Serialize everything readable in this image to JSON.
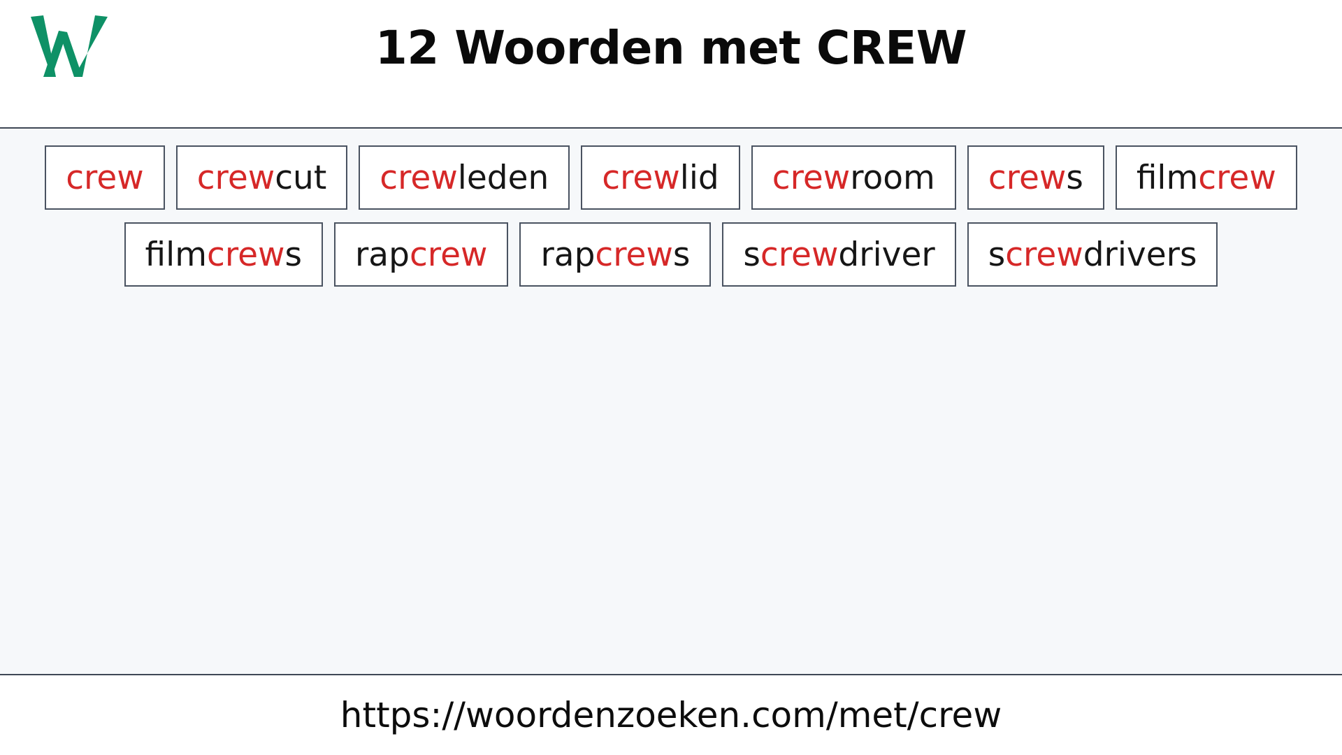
{
  "header": {
    "logo_icon": "w-logo-icon",
    "logo_letter": "W",
    "logo_color": "#0e9166",
    "title": "12 Woorden met CREW"
  },
  "theme": {
    "highlight_color": "#d62828",
    "text_color": "#161616",
    "chip_border_color": "#4a5361",
    "content_background": "#f6f8fa",
    "rule_color": "#3f4855"
  },
  "main": {
    "rows": [
      {
        "chips": [
          {
            "word": "crew",
            "parts": [
              {
                "text": "crew",
                "highlight": true
              }
            ]
          },
          {
            "word": "crewcut",
            "parts": [
              {
                "text": "crew",
                "highlight": true
              },
              {
                "text": "cut",
                "highlight": false
              }
            ]
          },
          {
            "word": "crewleden",
            "parts": [
              {
                "text": "crew",
                "highlight": true
              },
              {
                "text": "leden",
                "highlight": false
              }
            ]
          },
          {
            "word": "crewlid",
            "parts": [
              {
                "text": "crew",
                "highlight": true
              },
              {
                "text": "lid",
                "highlight": false
              }
            ]
          },
          {
            "word": "crewroom",
            "parts": [
              {
                "text": "crew",
                "highlight": true
              },
              {
                "text": "room",
                "highlight": false
              }
            ]
          },
          {
            "word": "crews",
            "parts": [
              {
                "text": "crew",
                "highlight": true
              },
              {
                "text": "s",
                "highlight": false
              }
            ]
          },
          {
            "word": "filmcrew",
            "parts": [
              {
                "text": "film",
                "highlight": false
              },
              {
                "text": "crew",
                "highlight": true
              }
            ]
          }
        ]
      },
      {
        "chips": [
          {
            "word": "filmcrews",
            "parts": [
              {
                "text": "film",
                "highlight": false
              },
              {
                "text": "crew",
                "highlight": true
              },
              {
                "text": "s",
                "highlight": false
              }
            ]
          },
          {
            "word": "rapcrew",
            "parts": [
              {
                "text": "rap",
                "highlight": false
              },
              {
                "text": "crew",
                "highlight": true
              }
            ]
          },
          {
            "word": "rapcrews",
            "parts": [
              {
                "text": "rap",
                "highlight": false
              },
              {
                "text": "crew",
                "highlight": true
              },
              {
                "text": "s",
                "highlight": false
              }
            ]
          },
          {
            "word": "screwdriver",
            "parts": [
              {
                "text": "s",
                "highlight": false
              },
              {
                "text": "crew",
                "highlight": true
              },
              {
                "text": "driver",
                "highlight": false
              }
            ]
          },
          {
            "word": "screwdrivers",
            "parts": [
              {
                "text": "s",
                "highlight": false
              },
              {
                "text": "crew",
                "highlight": true
              },
              {
                "text": "drivers",
                "highlight": false
              }
            ]
          }
        ]
      }
    ]
  },
  "footer": {
    "url": "https://woordenzoeken.com/met/crew"
  }
}
